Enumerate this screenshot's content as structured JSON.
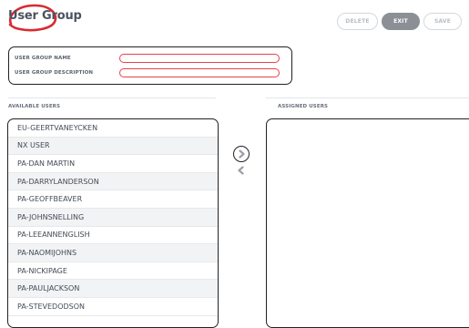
{
  "header": {
    "title": "User Group"
  },
  "actions": {
    "delete_label": "DELETE",
    "exit_label": "EXIT",
    "save_label": "SAVE"
  },
  "form": {
    "name_label": "USER GROUP NAME",
    "name_value": "",
    "description_label": "USER GROUP DESCRIPTION",
    "description_value": ""
  },
  "available": {
    "label": "AVAILABLE USERS",
    "users": [
      "EU-GEERTVANEYCKEN",
      "NX USER",
      "PA-DAN MARTIN",
      "PA-DARRYLANDERSON",
      "PA-GEOFFBEAVER",
      "PA-JOHNSNELLING",
      "PA-LEEANNENGLISH",
      "PA-NAOMIJOHNS",
      "PA-NICKIPAGE",
      "PA-PAULJACKSON",
      "PA-STEVEDODSON"
    ]
  },
  "assigned": {
    "label": "ASSIGNED USERS",
    "users": []
  },
  "colors": {
    "highlight": "#e8404a",
    "exit_button": "#8b8f96",
    "text": "#4a5564"
  },
  "icons": {
    "move_right": "chevron-right-icon",
    "move_left": "chevron-left-icon"
  }
}
